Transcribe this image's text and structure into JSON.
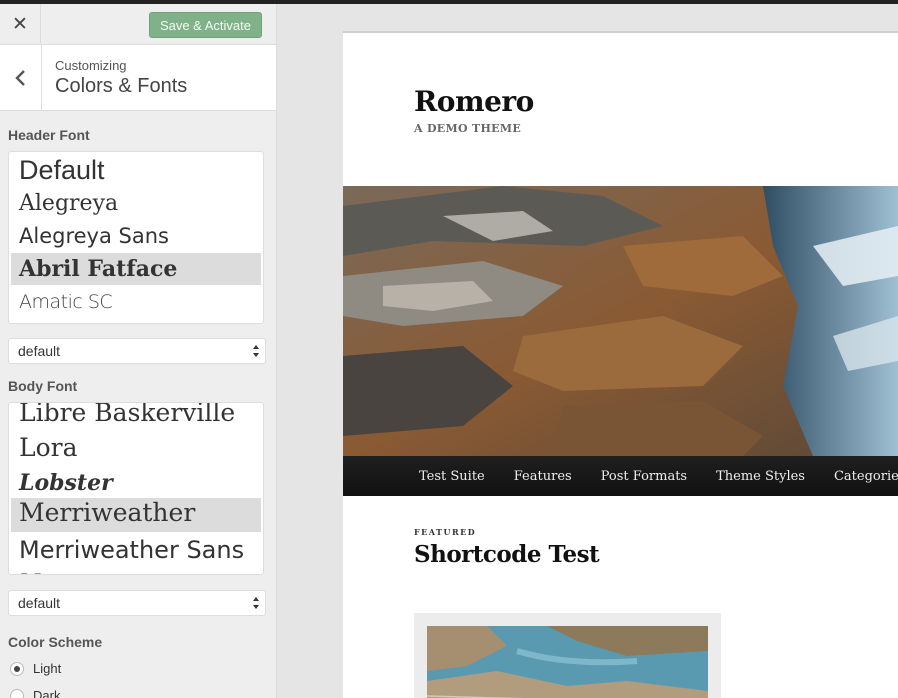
{
  "colors": {
    "save": "#80b28a",
    "nav_bg": "#1a1a1a",
    "selected": "#dcdcdc"
  },
  "toolbar": {
    "close_icon": "close-icon",
    "save_label": "Save & Activate"
  },
  "section": {
    "subtitle": "Customizing",
    "title": "Colors & Fonts",
    "back_icon": "chevron-left-icon"
  },
  "header_font": {
    "label": "Header Font",
    "options": [
      "Default",
      "Alegreya",
      "Alegreya Sans",
      "Abril Fatface",
      "Amatic SC"
    ],
    "selected": "Abril Fatface",
    "select_value": "default"
  },
  "body_font": {
    "label": "Body Font",
    "options": [
      "Libre Baskerville",
      "Lora",
      "Lobster",
      "Merriweather",
      "Merriweather Sans",
      "Montserrat"
    ],
    "selected": "Merriweather",
    "select_value": "default"
  },
  "color_scheme": {
    "label": "Color Scheme",
    "options": [
      {
        "label": "Light",
        "checked": true
      },
      {
        "label": "Dark",
        "checked": false
      }
    ]
  },
  "preview": {
    "site_title": "Romero",
    "site_description": "A DEMO THEME",
    "nav": [
      "Test Suite",
      "Features",
      "Post Formats",
      "Theme Styles",
      "Categories"
    ],
    "post_kicker": "FEATURED",
    "post_title": "Shortcode Test"
  }
}
